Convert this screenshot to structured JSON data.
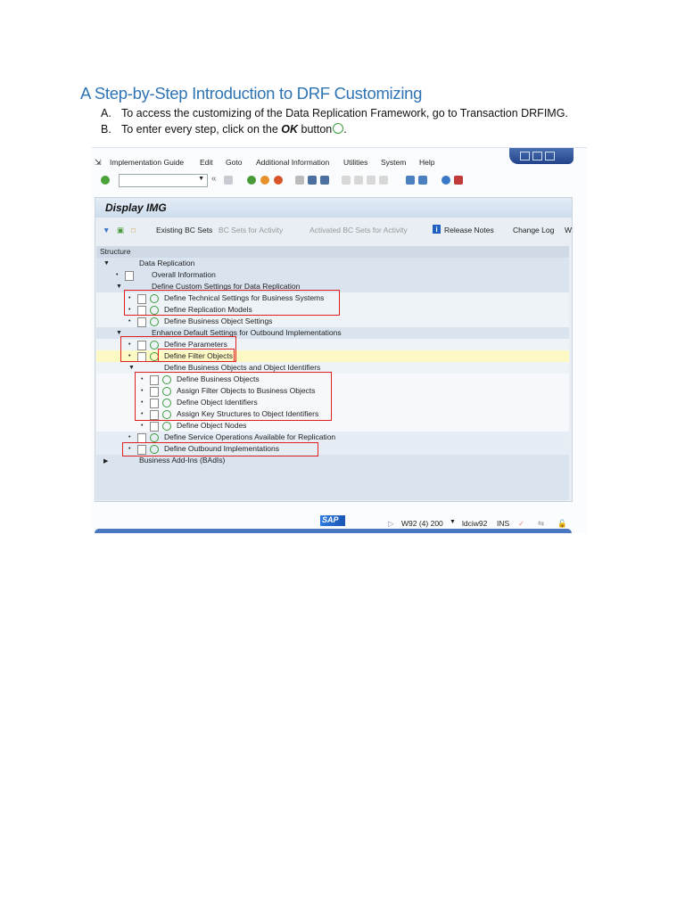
{
  "document": {
    "title": "A Step-by-Step Introduction to DRF Customizing",
    "steps": [
      {
        "label": "A.",
        "text": "To access the customizing of the Data Replication Framework, go to Transaction DRFIMG."
      },
      {
        "label": "B.",
        "text_before": "To enter every step, click on the ",
        "bold": "OK",
        "text_after": " button",
        "end": "."
      }
    ]
  },
  "sap": {
    "menu": [
      "Implementation Guide",
      "Edit",
      "Goto",
      "Additional Information",
      "Utilities",
      "System",
      "Help"
    ],
    "panel_title": "Display IMG",
    "app_toolbar": [
      "Existing BC Sets",
      "BC Sets for Activity",
      "Activated BC Sets for Activity",
      "Release Notes",
      "Change Log",
      "W"
    ],
    "structure_label": "Structure",
    "tree": [
      {
        "level": 0,
        "type": "folder",
        "text": "Data Replication"
      },
      {
        "level": 1,
        "type": "doc",
        "text": "Overall Information"
      },
      {
        "level": 1,
        "type": "folder",
        "text": "Define Custom Settings for Data Replication"
      },
      {
        "level": 2,
        "type": "activity",
        "text": "Define Technical Settings for Business Systems"
      },
      {
        "level": 2,
        "type": "activity",
        "text": "Define Replication Models"
      },
      {
        "level": 2,
        "type": "activity",
        "text": "Define Business Object Settings"
      },
      {
        "level": 1,
        "type": "folder",
        "text": "Enhance Default Settings for Outbound Implementations"
      },
      {
        "level": 2,
        "type": "activity",
        "text": "Define Parameters"
      },
      {
        "level": 2,
        "type": "activity",
        "text": "Define Filter Objects",
        "selected": true
      },
      {
        "level": 2,
        "type": "folder",
        "text": "Define Business Objects and Object Identifiers"
      },
      {
        "level": 3,
        "type": "activity",
        "text": "Define Business Objects"
      },
      {
        "level": 3,
        "type": "activity",
        "text": "Assign Filter Objects to Business Objects"
      },
      {
        "level": 3,
        "type": "activity",
        "text": "Define Object Identifiers"
      },
      {
        "level": 3,
        "type": "activity",
        "text": "Assign Key Structures to Object Identifiers"
      },
      {
        "level": 3,
        "type": "activity",
        "text": "Define Object Nodes"
      },
      {
        "level": 2,
        "type": "activity",
        "text": "Define Service Operations Available for Replication"
      },
      {
        "level": 2,
        "type": "activity",
        "text": "Define Outbound Implementations"
      },
      {
        "level": 0,
        "type": "collapsed",
        "text": "Business Add-Ins (BAdIs)"
      }
    ],
    "status": {
      "logo": "SAP",
      "system": "W92 (4) 200",
      "server": "ldciw92",
      "mode": "INS"
    },
    "colors": {
      "title": "#2e74b5",
      "highlight": "#fdf9c4",
      "annotation": "#e02020"
    }
  }
}
